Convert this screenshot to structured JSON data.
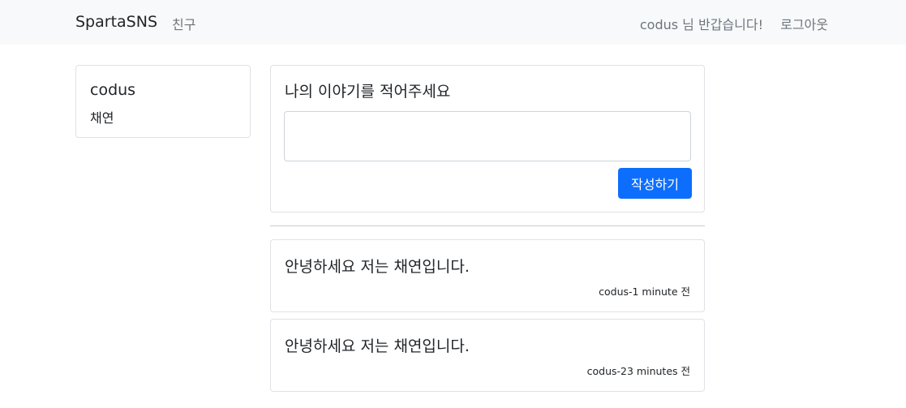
{
  "navbar": {
    "brand": "SpartaSNS",
    "friends_link": "친구",
    "greeting": "codus 님 반갑습니다!",
    "logout_link": "로그아웃"
  },
  "profile": {
    "username": "codus",
    "display_name": "채연"
  },
  "compose": {
    "title": "나의 이야기를 적어주세요",
    "input_value": "",
    "submit_label": "작성하기",
    "button_color": "#0d6efd"
  },
  "posts": [
    {
      "text": "안녕하세요 저는 채연입니다.",
      "meta": "codus-1 minute 전"
    },
    {
      "text": "안녕하세요 저는 채연입니다.",
      "meta": "codus-23 minutes 전"
    }
  ]
}
